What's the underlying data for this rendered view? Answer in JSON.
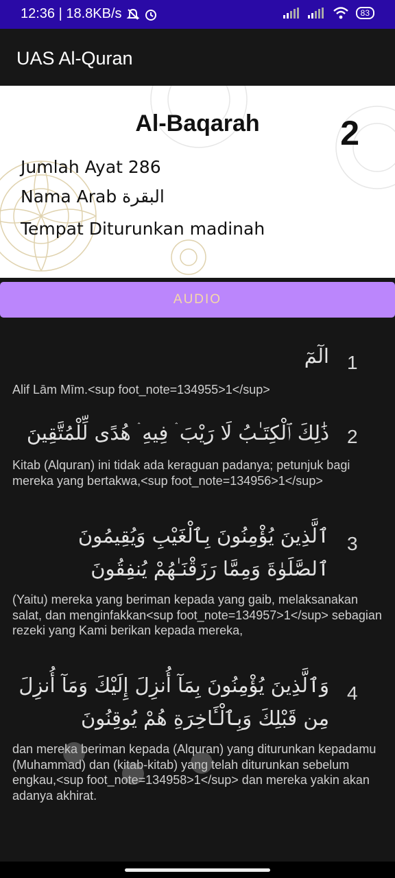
{
  "status": {
    "time_net": "12:36 | 18.8KB/s",
    "battery": "83"
  },
  "app": {
    "title": "UAS Al-Quran"
  },
  "surah": {
    "name": "Al-Baqarah",
    "number": "2",
    "ayah_count_label": "Jumlah Ayat",
    "ayah_count": "286",
    "arabic_name_label": "Nama Arab",
    "arabic_name": "البقرة",
    "revelation_label": "Tempat Diturunkan",
    "revelation": "madinah"
  },
  "audio_label": "AUDIO",
  "ayahs": [
    {
      "number": "1",
      "arabic": "الٓمٓ",
      "translation": "Alif Lām Mīm.<sup foot_note=134955>1</sup>"
    },
    {
      "number": "2",
      "arabic": "ذَٰلِكَ ٱلْكِتَـٰبُ لَا رَيْبَ ۛ فِيهِ ۛ هُدًى لِّلْمُتَّقِينَ",
      "translation": "Kitab (Alquran) ini tidak ada keraguan padanya; petunjuk bagi mereka yang bertakwa,<sup foot_note=134956>1</sup>"
    },
    {
      "number": "3",
      "arabic": "ٱلَّذِينَ يُؤْمِنُونَ بِٱلْغَيْبِ وَيُقِيمُونَ ٱلصَّلَوٰةَ وَمِمَّا رَزَقْنَـٰهُمْ يُنفِقُونَ",
      "translation": "(Yaitu) mereka yang beriman kepada yang gaib, melaksanakan salat, dan menginfakkan<sup foot_note=134957>1</sup> sebagian rezeki yang Kami berikan kepada mereka,"
    },
    {
      "number": "4",
      "arabic": "وَٱلَّذِينَ يُؤْمِنُونَ بِمَآ أُنزِلَ إِلَيْكَ وَمَآ أُنزِلَ مِن قَبْلِكَ وَبِٱلْـَٔاخِرَةِ هُمْ يُوقِنُونَ",
      "translation": "dan mereka beriman kepada (Alquran) yang diturunkan kepadamu (Muhammad) dan (kitab-kitab) yang telah diturunkan sebelum engkau,<sup foot_note=134958>1</sup> dan mereka yakin akan adanya akhirat."
    }
  ],
  "icons": [
    "mute-icon",
    "alarm-icon",
    "signal-icon",
    "wifi-icon",
    "battery-icon"
  ]
}
